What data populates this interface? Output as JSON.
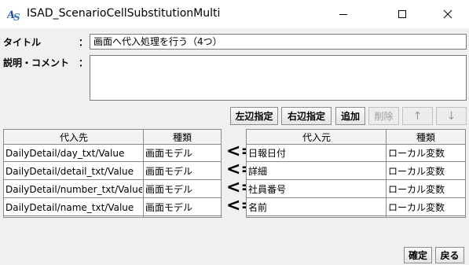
{
  "window": {
    "title": "ISAD_ScenarioCellSubstitutionMulti",
    "app_icon": "isad-logo-icon"
  },
  "form": {
    "title_label": "タイトル",
    "title_colon": "：",
    "title_value": "画面へ代入処理を行う（4つ）",
    "desc_label": "説明・コメント",
    "desc_colon": "：",
    "desc_value": ""
  },
  "toolbar": {
    "left_assign": "左辺指定",
    "right_assign": "右辺指定",
    "add": "追加",
    "delete": "削除",
    "up": "↑",
    "down": "↓"
  },
  "left_table": {
    "headers": [
      "代入先",
      "種類"
    ],
    "rows": [
      [
        "DailyDetail/day_txt/Value",
        "画面モデル"
      ],
      [
        "DailyDetail/detail_txt/Value",
        "画面モデル"
      ],
      [
        "DailyDetail/number_txt/Value",
        "画面モデル"
      ],
      [
        "DailyDetail/name_txt/Value",
        "画面モデル"
      ]
    ]
  },
  "assign_arrow": "<=",
  "right_table": {
    "headers": [
      "代入元",
      "種類"
    ],
    "rows": [
      [
        "日報日付",
        "ローカル変数"
      ],
      [
        "詳細",
        "ローカル変数"
      ],
      [
        "社員番号",
        "ローカル変数"
      ],
      [
        "名前",
        "ローカル変数"
      ]
    ]
  },
  "footer": {
    "ok": "確定",
    "back": "戻る"
  }
}
